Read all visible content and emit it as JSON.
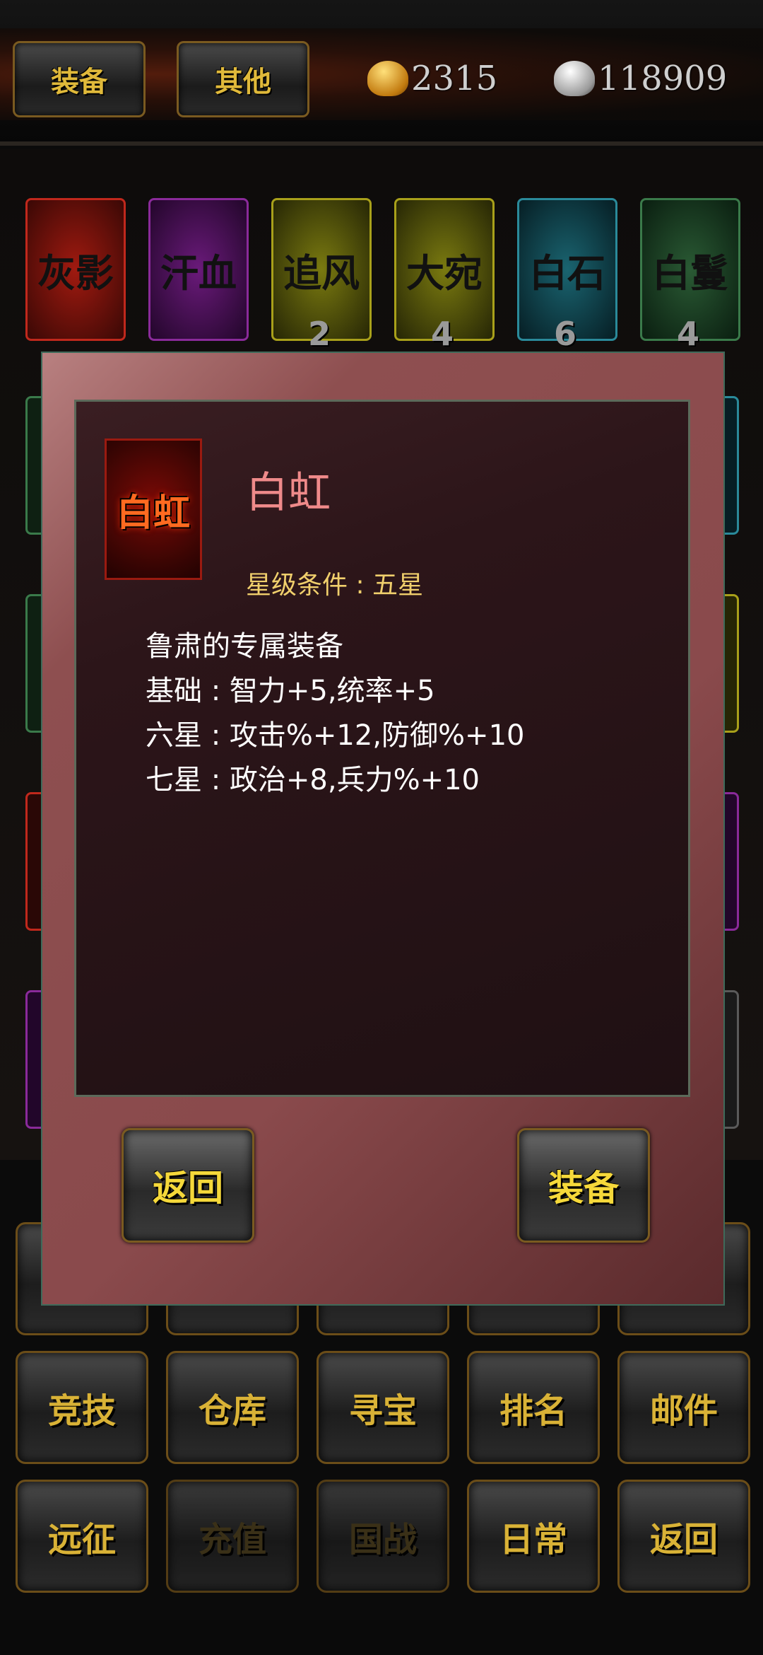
{
  "topbar": {
    "tabs": [
      "装备",
      "其他"
    ],
    "gold": "2315",
    "silver": "118909"
  },
  "horses": [
    {
      "name": "灰影",
      "count": "",
      "color": "#c0281c"
    },
    {
      "name": "汗血",
      "count": "",
      "color": "#8a2a9a"
    },
    {
      "name": "追风",
      "count": "2",
      "color": "#a8a01a"
    },
    {
      "name": "大宛",
      "count": "4",
      "color": "#a8a01a"
    },
    {
      "name": "白石",
      "count": "6",
      "color": "#2a8a9a"
    },
    {
      "name": "白鬘",
      "count": "4",
      "color": "#3a7a4a"
    }
  ],
  "menu": {
    "row2": [
      "竞技",
      "仓库",
      "寻宝",
      "排名",
      "邮件"
    ],
    "row3": [
      "远征",
      "充值",
      "国战",
      "日常",
      "返回"
    ]
  },
  "dialog": {
    "item_name": "白虹",
    "item_icon_text": "白虹",
    "star_requirement": "星级条件 : 五星",
    "desc_lines": [
      "鲁肃的专属装备",
      "基础 : 智力+5,统率+5",
      "六星 : 攻击%+12,防御%+10",
      "七星 : 政治+8,兵力%+10"
    ],
    "back_label": "返回",
    "equip_label": "装备"
  }
}
